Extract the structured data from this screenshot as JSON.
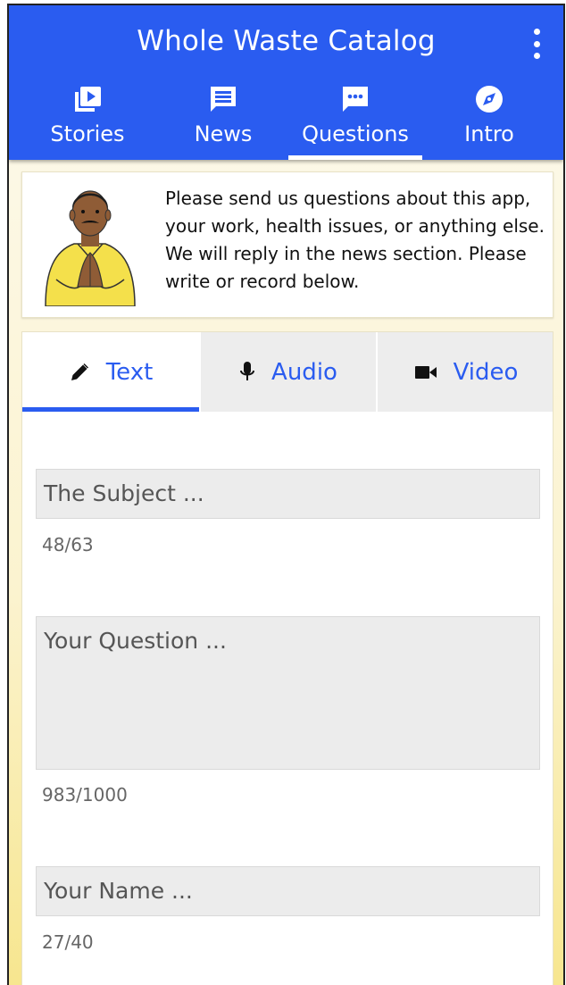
{
  "app": {
    "title": "Whole Waste Catalog"
  },
  "nav": {
    "tabs": [
      {
        "label": "Stories",
        "icon": "play-stack-icon"
      },
      {
        "label": "News",
        "icon": "message-lines-icon"
      },
      {
        "label": "Questions",
        "icon": "chat-dots-icon",
        "active": true
      },
      {
        "label": "Intro",
        "icon": "compass-icon"
      }
    ]
  },
  "intro": {
    "text": "Please send us questions about this app, your work, health issues, or anything else. We will reply in the news section. Please write or record below."
  },
  "form": {
    "modes": [
      {
        "label": "Text",
        "icon": "pencil-icon",
        "active": true
      },
      {
        "label": "Audio",
        "icon": "microphone-icon"
      },
      {
        "label": "Video",
        "icon": "video-camera-icon"
      }
    ],
    "subject": {
      "placeholder": "The Subject ...",
      "counter": "48/63"
    },
    "question": {
      "placeholder": "Your Question ...",
      "counter": "983/1000"
    },
    "name": {
      "placeholder": "Your Name ...",
      "counter": "27/40"
    }
  },
  "colors": {
    "primary": "#2a5cf0",
    "field_bg": "#ececec",
    "page_bg": "#fbf3cf"
  }
}
